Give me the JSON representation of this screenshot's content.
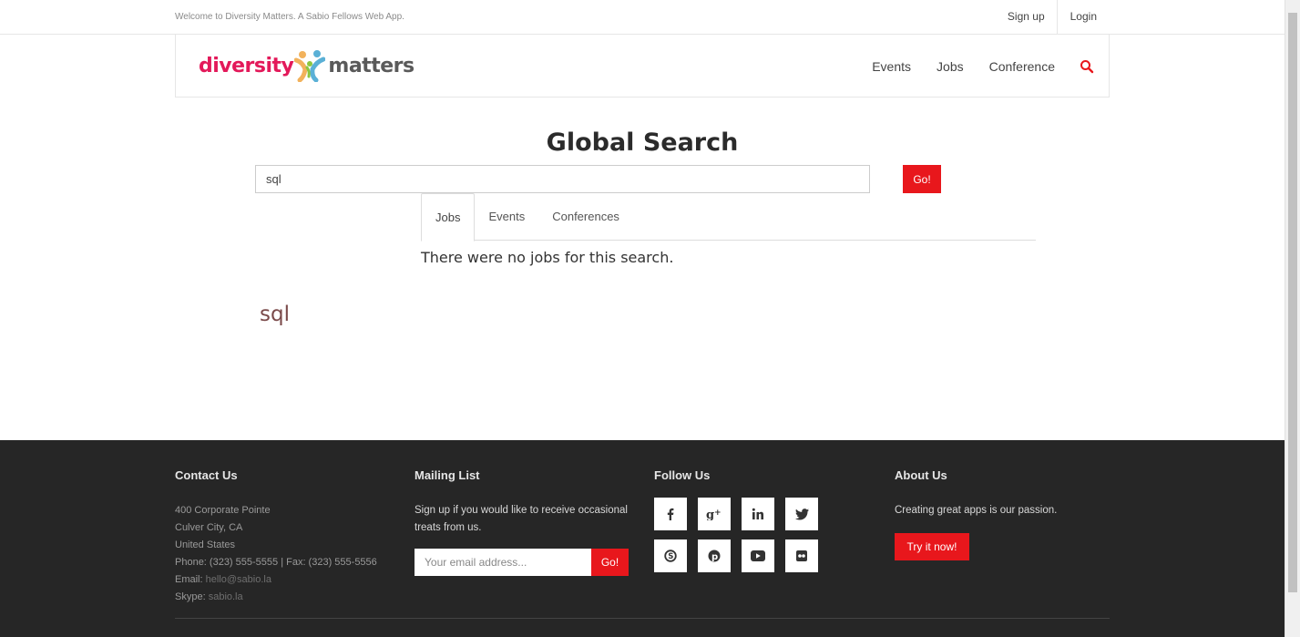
{
  "topbar": {
    "welcome": "Welcome to Diversity Matters. A Sabio Fellows Web App.",
    "signup": "Sign up",
    "login": "Login"
  },
  "header": {
    "logo_part1": "diversity",
    "logo_part2": "matters",
    "nav": [
      "Events",
      "Jobs",
      "Conference"
    ],
    "search_icon": "search-icon"
  },
  "main": {
    "title": "Global Search",
    "search_value": "sql",
    "go_label": "Go!",
    "tabs": [
      "Jobs",
      "Events",
      "Conferences"
    ],
    "active_tab": "Jobs",
    "no_results": "There were no jobs for this search.",
    "query_echo": "sql"
  },
  "footer": {
    "contact": {
      "heading": "Contact Us",
      "address1": "400 Corporate Pointe",
      "address2": "Culver City, CA",
      "country": "United States",
      "phone": "Phone: (323) 555-5555 | Fax: (323) 555-5556",
      "email_label": "Email:",
      "email": "hello@sabio.la",
      "skype_label": "Skype:",
      "skype": "sabio.la"
    },
    "mailing": {
      "heading": "Mailing List",
      "text": "Sign up if you would like to receive occasional treats from us.",
      "placeholder": "Your email address...",
      "go_label": "Go!"
    },
    "follow": {
      "heading": "Follow Us",
      "icons": [
        "facebook-icon",
        "google-plus-icon",
        "linkedin-icon",
        "twitter-icon",
        "skype-icon",
        "pinterest-icon",
        "youtube-icon",
        "flickr-icon"
      ]
    },
    "about": {
      "heading": "About Us",
      "text": "Creating great apps is our passion.",
      "button": "Try it now!"
    }
  },
  "colors": {
    "accent": "#e8171c",
    "logo_pink": "#e3195a",
    "footer_bg": "#262626"
  }
}
